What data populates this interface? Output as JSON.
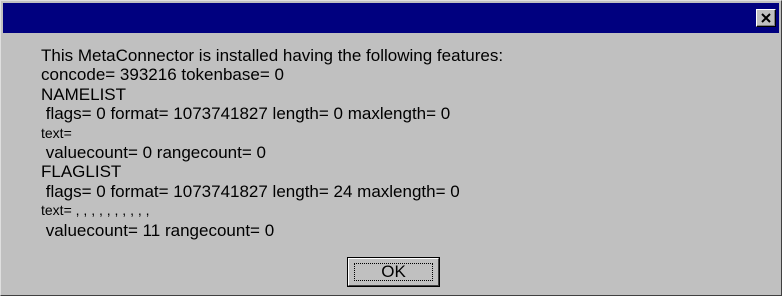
{
  "dialog": {
    "title": "",
    "lines": [
      "This MetaConnector is installed having the following features:",
      "concode= 393216 tokenbase= 0",
      "NAMELIST",
      " flags= 0 format= 1073741827 length= 0 maxlength= 0",
      "text=",
      " valuecount= 0 rangecount= 0",
      "FLAGLIST",
      " flags= 0 format= 1073741827 length= 24 maxlength= 0",
      "text= , , , , , , , , , ,",
      " valuecount= 11 rangecount= 0"
    ],
    "ok_label": "OK"
  },
  "colors": {
    "titlebar": "#00007f",
    "face": "#c0c0c0",
    "text": "#000000"
  },
  "icons": {
    "close": "close-icon"
  }
}
